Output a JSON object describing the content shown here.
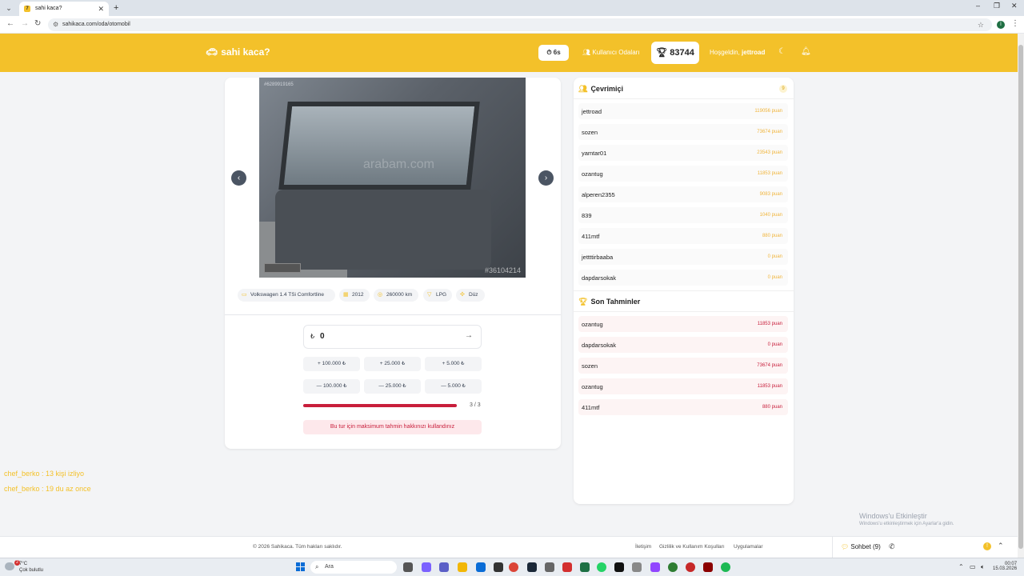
{
  "browser": {
    "tab_title": "sahi kaca?",
    "tab_favicon": "7",
    "url": "sahikaca.com/oda/otomobil",
    "profile_initial": "İ"
  },
  "header": {
    "brand": "sahi kaca?",
    "timer": "6s",
    "rooms_link": "Kullanıcı Odaları",
    "score": "83744",
    "welcome_prefix": "Hoşgeldin,",
    "username": "jettroad",
    "colors": {
      "brand_yellow": "#f3c12a",
      "accent_red": "#c81e3b"
    }
  },
  "listing": {
    "photo_top_id": "#6289919165",
    "photo_watermark": "arabam.com",
    "photo_code": "#36104214",
    "tags": [
      {
        "icon": "car-icon",
        "label": "Volkswagen 1.4 TSi Comfortline"
      },
      {
        "icon": "calendar-icon",
        "label": "2012"
      },
      {
        "icon": "speed-icon",
        "label": "260000 km"
      },
      {
        "icon": "fuel-icon",
        "label": "LPG"
      },
      {
        "icon": "gear-icon",
        "label": "Düz"
      }
    ]
  },
  "guess": {
    "currency": "₺",
    "value": "0",
    "increase_buttons": [
      "100.000 ₺",
      "25.000 ₺",
      "5.000 ₺"
    ],
    "decrease_buttons": [
      "100.000 ₺",
      "25.000 ₺",
      "5.000 ₺"
    ],
    "attempts_label": "3 / 3",
    "attempts_used": 3,
    "attempts_total": 3,
    "limit_message": "Bu tur için maksimum tahmin hakkınızı kullandınız"
  },
  "online": {
    "title": "Çevrimiçi",
    "count": "9",
    "users": [
      {
        "name": "jettroad",
        "points": "119056 puan"
      },
      {
        "name": "sozen",
        "points": "73674 puan"
      },
      {
        "name": "yamtar01",
        "points": "23543 puan"
      },
      {
        "name": "ozantug",
        "points": "11853 puan"
      },
      {
        "name": "alperen2355",
        "points": "9083 puan"
      },
      {
        "name": "839",
        "points": "1040 puan"
      },
      {
        "name": "411mtf",
        "points": "880 puan"
      },
      {
        "name": "jettttirbaaba",
        "points": "0 puan"
      },
      {
        "name": "dapdarsokak",
        "points": "0 puan"
      }
    ]
  },
  "recent_guesses": {
    "title": "Son Tahminler",
    "items": [
      {
        "name": "ozantug",
        "points": "11853 puan"
      },
      {
        "name": "dapdarsokak",
        "points": "0 puan"
      },
      {
        "name": "sozen",
        "points": "73674 puan"
      },
      {
        "name": "ozantug",
        "points": "11853 puan"
      },
      {
        "name": "411mtf",
        "points": "880 puan"
      }
    ]
  },
  "overlay": [
    {
      "user": "chef_berko",
      "message": ": 13 kişi izliyo"
    },
    {
      "user": "chef_berko",
      "message": ": 19 du az once"
    }
  ],
  "windows_activation": {
    "title": "Windows'u Etkinleştir",
    "subtitle": "Windows'u etkinleştirmek için Ayarlar'a gidin."
  },
  "footer": {
    "copyright": "© 2026 Sahikaca. Tüm hakları saklıdır.",
    "links": [
      "İletişim",
      "Gizlilik ve Kullanım Koşulları",
      "Uygulamalar"
    ],
    "chat_label": "Sohbet (9)"
  },
  "taskbar": {
    "weather_temp": "7°C",
    "weather_desc": "Çok bulutlu",
    "weather_badge": "2",
    "search_placeholder": "Ara",
    "time": "00:07",
    "date": "15.03.2026"
  }
}
